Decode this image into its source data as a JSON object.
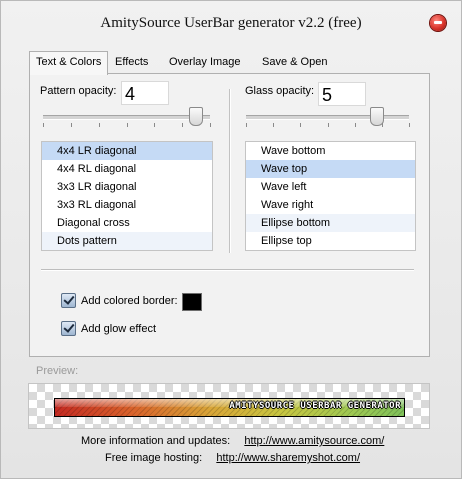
{
  "window": {
    "title": "AmitySource UserBar generator v2.2 (free)"
  },
  "tabs": [
    {
      "label": "Text & Colors",
      "active": true
    },
    {
      "label": "Effects",
      "active": false
    },
    {
      "label": "Overlay Image",
      "active": false
    },
    {
      "label": "Save & Open",
      "active": false
    }
  ],
  "pattern": {
    "label": "Pattern opacity:",
    "value": "4",
    "slider_fraction": 0.91,
    "items": [
      "4x4 LR diagonal",
      "4x4 RL diagonal",
      "3x3 LR diagonal",
      "3x3 RL diagonal",
      "Diagonal cross",
      "Dots pattern"
    ],
    "selected_index": 0
  },
  "glass": {
    "label": "Glass opacity:",
    "value": "5",
    "slider_fraction": 0.8,
    "items": [
      "Wave bottom",
      "Wave top",
      "Wave left",
      "Wave right",
      "Ellipse bottom",
      "Ellipse top"
    ],
    "selected_index": 1
  },
  "options": {
    "border_label": "Add colored border:",
    "border_checked": true,
    "border_color": "#000000",
    "glow_label": "Add glow effect",
    "glow_checked": true
  },
  "preview": {
    "label": "Preview:",
    "userbar_text": "AMITYSOURCE USERBAR GENERATOR"
  },
  "footer": {
    "info_label": "More information and updates:",
    "info_link": "http://www.amitysource.com/",
    "hosting_label": "Free image hosting:",
    "hosting_link": "http://www.sharemyshot.com/"
  }
}
